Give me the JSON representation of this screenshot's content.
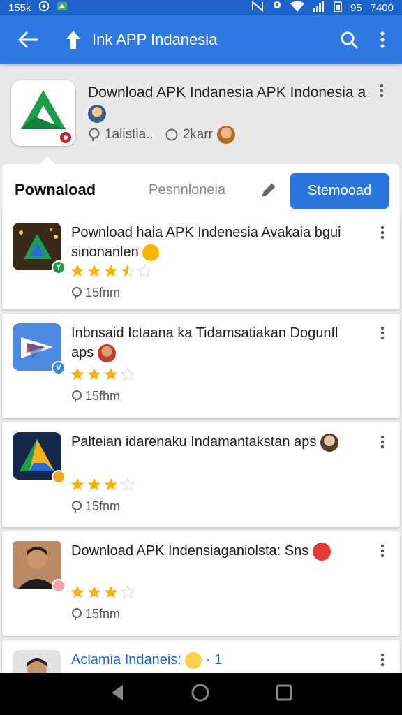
{
  "status_bar": {
    "left_text": "155k",
    "time": "7400",
    "battery": "95"
  },
  "app_bar": {
    "title": "Ink APP Indanesia"
  },
  "header": {
    "title": "Download APK Indanesia APK Indonesia a",
    "meta_1": "1alistia..",
    "meta_2": "2karr"
  },
  "tabs": {
    "primary": "Pownaload",
    "secondary": "Pesnnloneia",
    "download_button": "Stemooad"
  },
  "items": [
    {
      "title": "Pownload haia APK Indenesia Avakaia bgui sinonanlen",
      "count": "15fnm",
      "rating": 3.5,
      "badge": "Y"
    },
    {
      "title": "Inbnsaid Ictaana ka Tidamsatiakan Dogunfl aps",
      "count": "15fhm",
      "rating": 3,
      "badge": "V"
    },
    {
      "title": "Palteian idarenaku Indamantakstan aps",
      "count": "15fnm",
      "rating": 3,
      "badge": ""
    },
    {
      "title": "Download APK Indensiaganiolsta: Sns",
      "count": "15fnm",
      "rating": 3,
      "badge": ""
    },
    {
      "title": "Aclamia Indaneis:",
      "title_suffix": "· 1"
    }
  ],
  "colors": {
    "primary": "#2f7ae0",
    "status": "#1e63c9",
    "star": "#f5b400"
  }
}
